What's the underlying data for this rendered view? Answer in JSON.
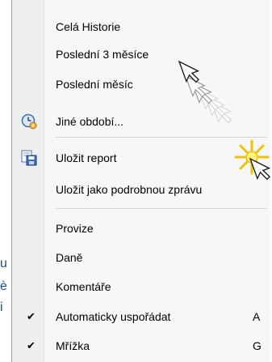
{
  "background_fragments": [
    "u",
    "è",
    "i"
  ],
  "menu": {
    "items": [
      {
        "label": "Celá Historie"
      },
      {
        "label": "Poslední 3 měsíce"
      },
      {
        "label": "Poslední měsíc"
      },
      {
        "label": "Jiné období...",
        "icon": "clock-settings-icon"
      },
      {
        "label": "Uložit report",
        "icon": "save-report-icon"
      },
      {
        "label": "Uložit jako podrobnou zprávu"
      },
      {
        "label": "Provize"
      },
      {
        "label": "Daně"
      },
      {
        "label": "Komentáře"
      },
      {
        "label": "Automaticky uspořádat",
        "checked": true,
        "shortcut": "A"
      },
      {
        "label": "Mřížka",
        "checked": true,
        "shortcut": "G"
      }
    ]
  },
  "colors": {
    "menu_background": "#f7f7f7",
    "icon_strip": "#efefef",
    "separator": "#d4d4d4",
    "background_text": "#1f4e8c"
  }
}
